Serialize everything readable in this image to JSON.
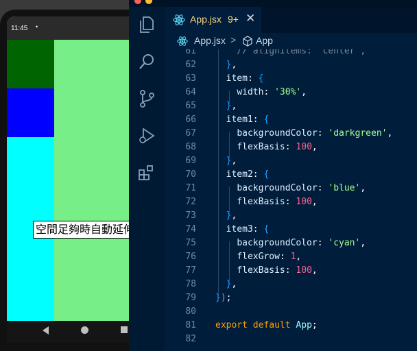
{
  "emulator": {
    "status_time": "11:45",
    "status_dot": "•",
    "label_text": "空間足夠時自動延伸",
    "colors": {
      "item1": "#006400",
      "item2": "#0000ff",
      "item3": "#00ffff",
      "container": "#77ee88"
    },
    "nav_icons": [
      "back-icon",
      "home-icon",
      "recents-icon"
    ]
  },
  "editor_tab": {
    "filename": "App.jsx",
    "badge": "9+",
    "close": "✕"
  },
  "breadcrumb": {
    "file": "App.jsx",
    "separator": ">",
    "symbol": "App"
  },
  "activity_icons": [
    "explorer-icon",
    "search-icon",
    "source-control-icon",
    "run-debug-icon",
    "extensions-icon"
  ],
  "code_lines": [
    {
      "num": "61",
      "text": "    // alignItems: 'center',"
    },
    {
      "num": "62",
      "text": "  },"
    },
    {
      "num": "63",
      "text": "  item: {"
    },
    {
      "num": "64",
      "text": "    width: '30%',"
    },
    {
      "num": "65",
      "text": "  },"
    },
    {
      "num": "66",
      "text": "  item1: {"
    },
    {
      "num": "67",
      "text": "    backgroundColor: 'darkgreen',"
    },
    {
      "num": "68",
      "text": "    flexBasis: 100,"
    },
    {
      "num": "69",
      "text": "  },"
    },
    {
      "num": "70",
      "text": "  item2: {"
    },
    {
      "num": "71",
      "text": "    backgroundColor: 'blue',"
    },
    {
      "num": "72",
      "text": "    flexBasis: 100,"
    },
    {
      "num": "73",
      "text": "  },"
    },
    {
      "num": "74",
      "text": "  item3: {"
    },
    {
      "num": "75",
      "text": "    backgroundColor: 'cyan',"
    },
    {
      "num": "76",
      "text": "    flexGrow: 1,"
    },
    {
      "num": "77",
      "text": "    flexBasis: 100,"
    },
    {
      "num": "78",
      "text": "  },"
    },
    {
      "num": "79",
      "text": "});"
    },
    {
      "num": "80",
      "text": ""
    },
    {
      "num": "81",
      "text": "export default App;"
    },
    {
      "num": "82",
      "text": ""
    }
  ]
}
